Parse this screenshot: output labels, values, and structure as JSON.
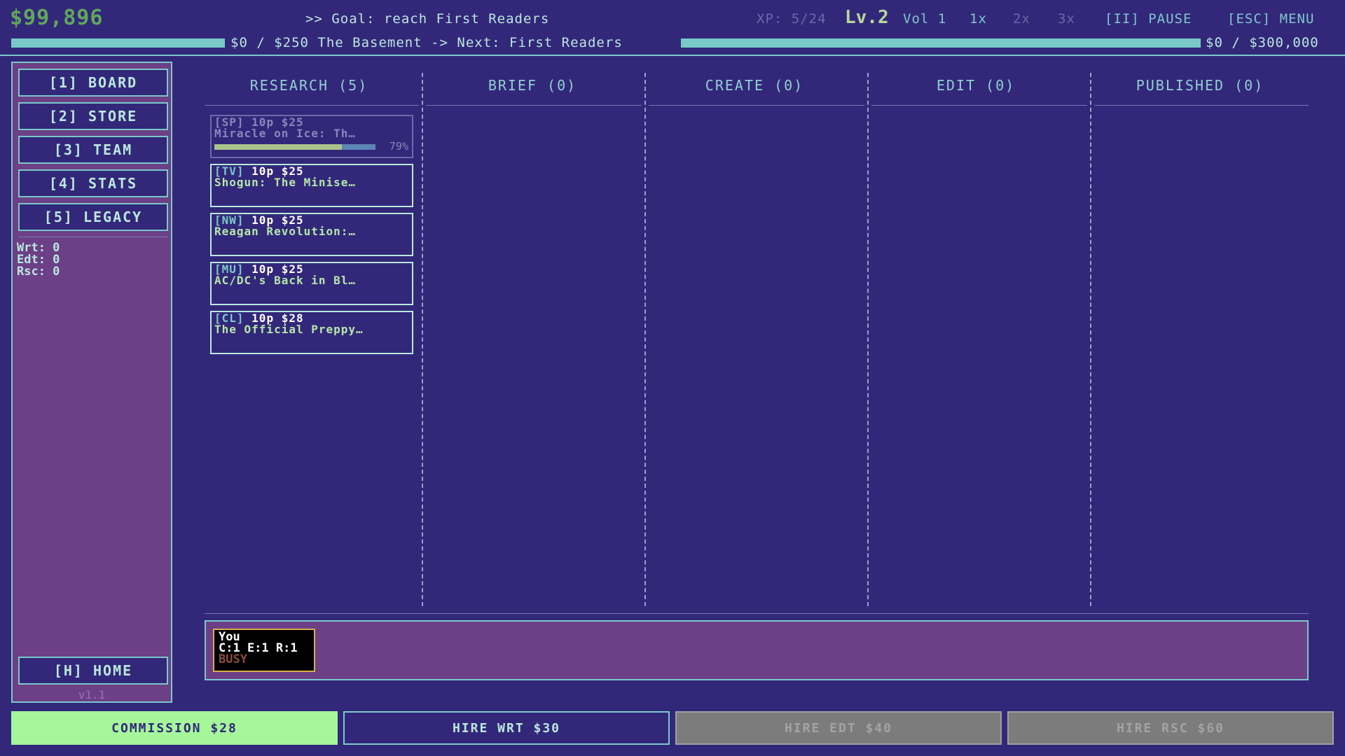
{
  "top": {
    "money": "$99,896",
    "goal": ">> Goal: reach First Readers",
    "xp": "XP: 5/24",
    "level": "Lv.2",
    "vol": "Vol 1",
    "speeds": [
      "1x",
      "2x",
      "3x"
    ],
    "pause": "[II] PAUSE",
    "menu": "[ESC] MENU",
    "left_bar_text": "$0 / $250 The Basement -> Next: First Readers",
    "right_bar_text": "$0 / $300,000",
    "left_bar_fill": 1.0,
    "right_bar_fill": 1.0
  },
  "sidebar": {
    "nav": [
      "[1] BOARD",
      "[2] STORE",
      "[3] TEAM",
      "[4] STATS",
      "[5] LEGACY"
    ],
    "stats": [
      "Wrt: 0",
      "Edt: 0",
      "Rsc: 0"
    ],
    "home": "[H] HOME",
    "version": "v1.1"
  },
  "columns": [
    "RESEARCH (5)",
    "BRIEF (0)",
    "CREATE (0)",
    "EDIT (0)",
    "PUBLISHED (0)"
  ],
  "cards": [
    {
      "tag": "[SP]",
      "meta": "10p $25",
      "title": "Miracle on Ice: Th…",
      "progress": 0.79,
      "pct": "79%"
    },
    {
      "tag": "[TV]",
      "meta": "10p $25",
      "title": "Shogun: The Minise…"
    },
    {
      "tag": "[NW]",
      "meta": "10p $25",
      "title": "Reagan Revolution:…"
    },
    {
      "tag": "[MU]",
      "meta": "10p $25",
      "title": "AC/DC's Back in Bl…"
    },
    {
      "tag": "[CL]",
      "meta": "10p $28",
      "title": "The Official Preppy…"
    }
  ],
  "staff": {
    "name": "You",
    "skills": "C:1 E:1 R:1",
    "status": "BUSY"
  },
  "buttons": {
    "commission": "COMMISSION $28",
    "hire_wrt": "HIRE WRT $30",
    "hire_edt": "HIRE EDT $40",
    "hire_rsc": "HIRE RSC $60"
  },
  "colors": {
    "background": "#33277a",
    "accent": "#79c9c9",
    "panel": "#6c3f87",
    "commission": "#a5f79a",
    "disabled": "#7c7c7c"
  }
}
